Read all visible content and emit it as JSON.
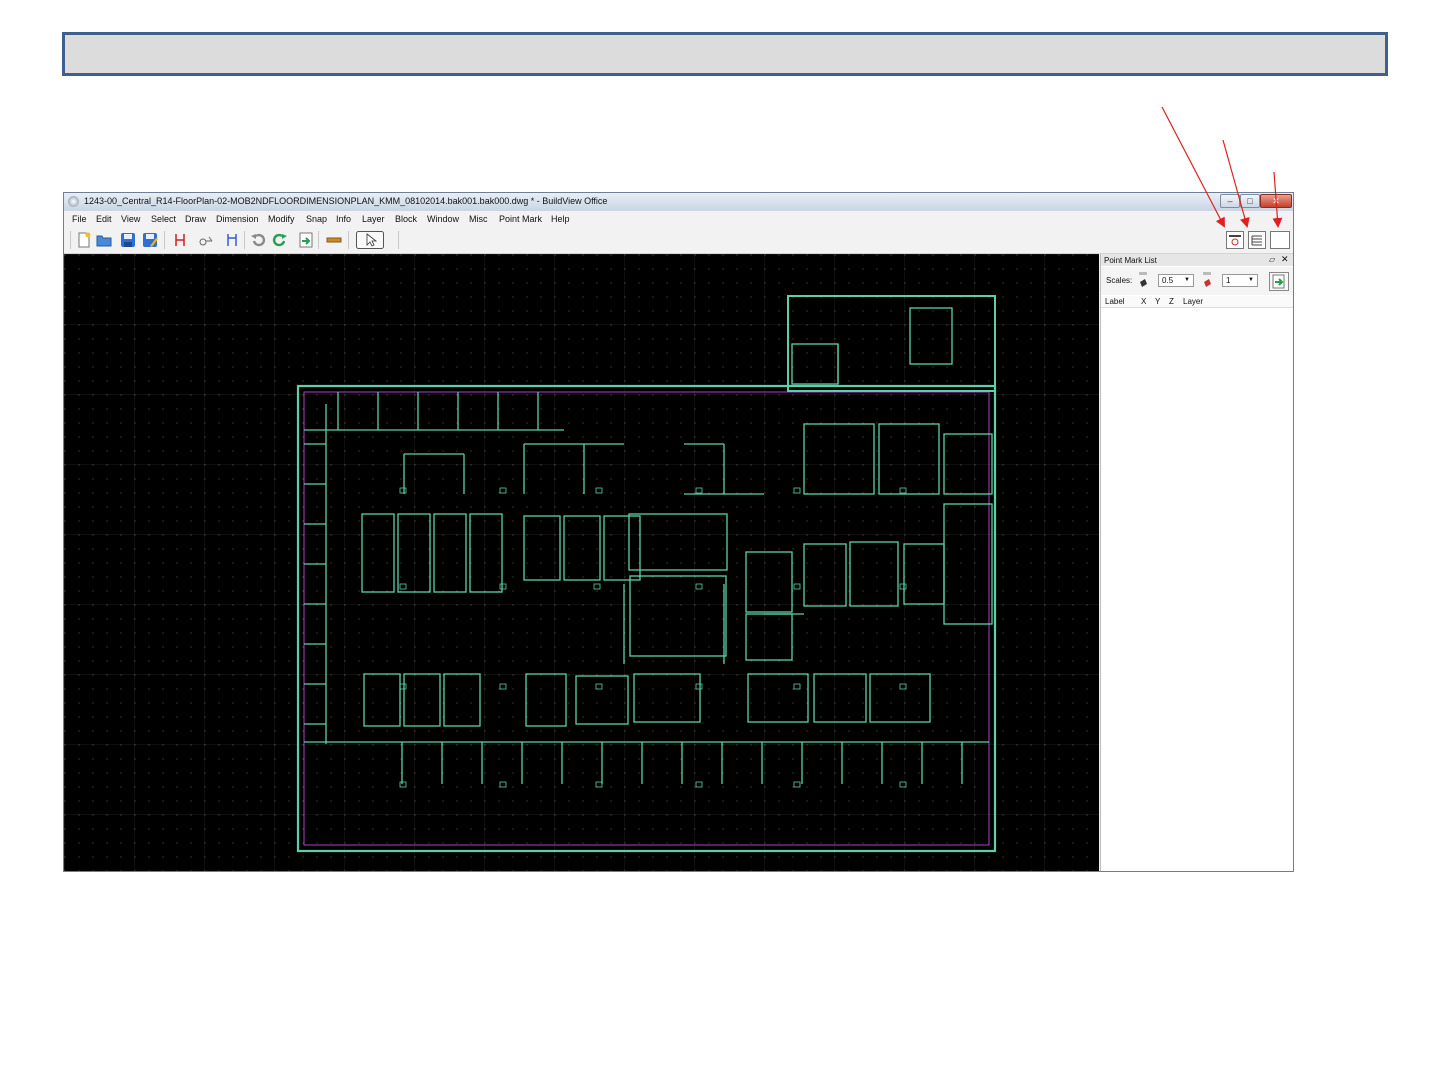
{
  "window": {
    "title": "1243-00_Central_R14-FloorPlan-02-MOB2NDFLOORDIMENSIONPLAN_KMM_08102014.bak001.bak000.dwg * - BuildView Office"
  },
  "menu": [
    "File",
    "Edit",
    "View",
    "Select",
    "Draw",
    "Dimension",
    "Modify",
    "Snap",
    "Info",
    "Layer",
    "Block",
    "Window",
    "Misc",
    "Point Mark",
    "Help"
  ],
  "panel": {
    "title": "Point Mark List",
    "scales_label": "Scales:",
    "scale1": "0.5",
    "scale2": "1",
    "columns": [
      "Label",
      "X",
      "Y",
      "Z",
      "Layer"
    ]
  },
  "colors": {
    "accent_banner_border": "#3f5f8f",
    "annotation_arrow": "#e02020",
    "cad_wall": "#5ad1a8",
    "cad_boundary": "#b040c0",
    "canvas_bg": "#000000"
  },
  "icons": [
    "new-file-icon",
    "open-folder-icon",
    "save-icon",
    "save-as-icon",
    "dimension-icon",
    "measure-icon",
    "undo-icon",
    "redo-icon",
    "import-icon",
    "ruler-icon",
    "pointer-icon",
    "point-mark-list-icon",
    "list-view-icon",
    "blank-panel-icon"
  ]
}
